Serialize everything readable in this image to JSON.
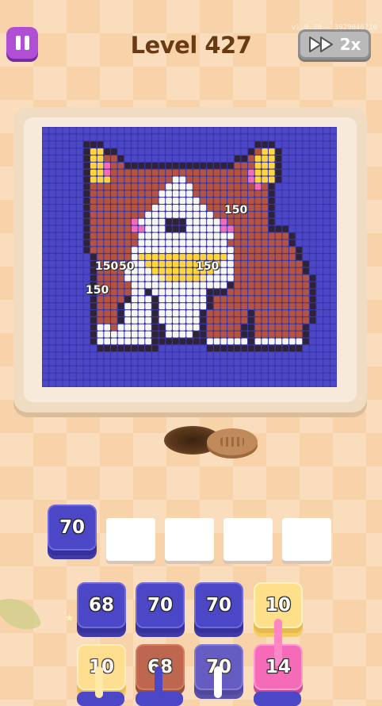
{
  "header": {
    "level_title": "Level 427",
    "version_text": "v1.0.38 - 3929046710",
    "speed_label": "2x"
  },
  "popups": [
    "150",
    "150",
    "50",
    "150",
    "150"
  ],
  "picture": {
    "palette": {
      "B": "#4c47c6",
      "K": "#2f2338",
      "R": "#b4533e",
      "W": "#f7f7f2",
      "Y": "#ffd73a",
      "P": "#f56bb8",
      "L": "#ffe88a"
    },
    "rows": [
      "BBBBBBBBBBBBBBBBBBBBBBBBBBBBBBBBBBBBBBBBBBB",
      "BBBBBBBBBBBBBBBBBBBBBBBBBBBBBBBBBBBBBBBBBBB",
      "BBBBBBKKKBBBBBBBBBBBBBBBBBBBBBBKKKBBBBBBBBB",
      "BBBBBBKYYKKBBBBBBBBBBBBBBBBBBBKRYYKBBBBBBBB",
      "BBBBBBKYYRRKBBBBBBBBBBBBBBBBKKRYYYKBBBBBBBB",
      "BBBBBBKYYPRRKKKKKKKKKKKKKKKKRRRYYYKBBBBBBBB",
      "BBBBBBKYYPRRRRRRRRRRRRRRRRRRRRPYYYKBBBBBBBB",
      "BBBBBBKYYYRRRRRRRRRWWRRRRRRRRRPYYYKBBBBBBBB",
      "BBBBBBKRRRRRRRRRRRWWWWRRRRRRRRRPRKBBBBBBBBB",
      "BBBBBBKRRRRRRRRRRWWWWWRRRRRRRRRRRKBBBBBBBBB",
      "BBBBBBKRRRRRRRRRRWWWWWWRRRRRRRRRRKBBBBBBBBB",
      "BBBBBBKRRRRRRRRRWWWWWWWWRRRRRRRRRKBBBBBBBBB",
      "BBBBBBKRRRRRRRRWWWWWWWWWWRRRRRRRRKBBBBBBBBB",
      "BBBBBBKRRRRRRPWWWWKKKWWWWWPRRRRRRKBBBBBBBBB",
      "BBBBBBKRRRRRRPPWWWKKKWWWWWPPRRRRRKKKBBBBBBB",
      "BBBBBBKRRRRRRRWWWWWWWWWWWWWWRRRRRRRRKBBBBBB",
      "BBBBBBKRRRRRRRWWWWWWWWWWWWWRRRRRRRRRKBBBBBB",
      "BBBBBBKRRRRRRWWWWWWWWWWWWWWWRRRRRRRRRKBBBBB",
      "BBBBBBBKRRRRRWYYYYYYYYYYYYYWRRRRRRRRRKBBBBB",
      "BBBBBBBKRRRRRWWYYYYYYYYYYYWWRRRRRRRRRRKBBBB",
      "BBBBBBBKRRRRWWWWYYYYYYYYYWWWRRRRRRRRRRKBBBB",
      "BBBBBBBKRRRRWWWWWLYYYYYLWWWWRRRRRRRRRRRKBBB",
      "BBBBBBBKRRRRRWWWWWWWWWWWWWWKRRRRRRRRRRRKBBB",
      "BBBBBBBKRRRRRWWKWWWWWWWWKKKRRRRRRRRRRRRKBBB",
      "BBBBBBBKRRRRKWWWKWWWWWWWKRRRRRRRRRRRRRRKBBB",
      "BBBBBBBKRRRKWWWWKWWWWWWWKRRRRRRRRRRRRRRKBBB",
      "BBBBBBBKRRRKWWWWKWWWWWWKRRRRRRKRRRRRRRRKBBB",
      "BBBBBBBKRRRKWWWWKWWWWWWKRRRRRRKRRRRRRRRKBBB",
      "BBBBBBBKWWRWWWWWKKWWWWWKRRRRRKKRRRRRRRKBBBB",
      "BBBBBBBKWWWWWWWWKKWWWWKKRRRRRKKRRRRRRRKBBBB",
      "BBBBBBBKWWWWWWWWKKKKKKKKWWWWWWKWWWWWWWKBBBB",
      "BBBBBBBBKKKKKKKKKBBBBBBBKKKKKKKKKKKKKKBBBBB",
      "BBBBBBBBBBBBBBBBBBBBBBBBBBBBBBBBBBBBBBBBBBB",
      "BBBBBBBBBBBBBBBBBBBBBBBBBBBBBBBBBBBBBBBBBBB",
      "BBBBBBBBBBBBBBBBBBBBBBBBBBBBBBBBBBBBBBBBBBB",
      "BBBBBBBBBBBBBBBBBBBBBBBBBBBBBBBBBBBBBBBBBBB",
      "BBBBBBBBBBBBBBBBBBBBBBBBBBBBBBBBBBBBBBBBBBB"
    ]
  },
  "slots": {
    "active_tile": {
      "count": "70",
      "color": "#4c47c6"
    },
    "empty_count": 4
  },
  "queue": {
    "row1": [
      {
        "count": "68",
        "color": "blue"
      },
      {
        "count": "70",
        "color": "blue"
      },
      {
        "count": "70",
        "color": "blue"
      },
      {
        "count": "10",
        "color": "yellow"
      }
    ],
    "row2": [
      {
        "count": "10",
        "color": "yellow"
      },
      {
        "count": "68",
        "color": "brown"
      },
      {
        "count": "70",
        "color": "blue"
      },
      {
        "count": "14",
        "color": "pink"
      }
    ]
  },
  "icons": {
    "pause": "pause-icon",
    "speed": "fast-forward-icon"
  }
}
